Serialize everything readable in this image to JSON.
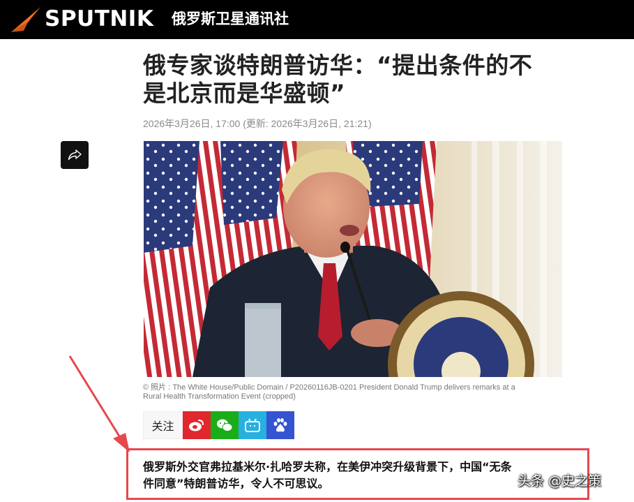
{
  "header": {
    "logo_text": "SPUTNIK",
    "agency_name": "俄罗斯卫星通讯社",
    "logo_color": "#f26d21"
  },
  "article": {
    "headline_line1": "俄专家谈特朗普访华：“提出条件的不",
    "headline_line2": "是北京而是华盛顿”",
    "dateline": "2026年3月26日, 17:00 (更新: 2026年3月26日, 21:21)",
    "photo_caption_line1": "© 照片 : The White House/Public Domain / P20260116JB-0201 President Donald Trump delivers remarks at a",
    "photo_caption_line2": "Rural Health Transformation Event (cropped)",
    "lead_line1": "俄罗斯外交官弗拉基米尔·扎哈罗夫称，在美伊冲突升级背景下，中国“无条",
    "lead_line2": "件同意”特朗普访华，令人不可思议。"
  },
  "social": {
    "follow_label": "关注",
    "icons": [
      "weibo-icon",
      "wechat-icon",
      "bilibili-icon",
      "baidu-icon"
    ]
  },
  "share": {
    "icon": "share-icon"
  },
  "watermark": "头条 @史之策",
  "colors": {
    "highlight_red": "#e5484d",
    "weibo": "#e0272d",
    "wechat": "#1aad19",
    "bilibili": "#27b0e0",
    "baidu": "#3454d1"
  }
}
